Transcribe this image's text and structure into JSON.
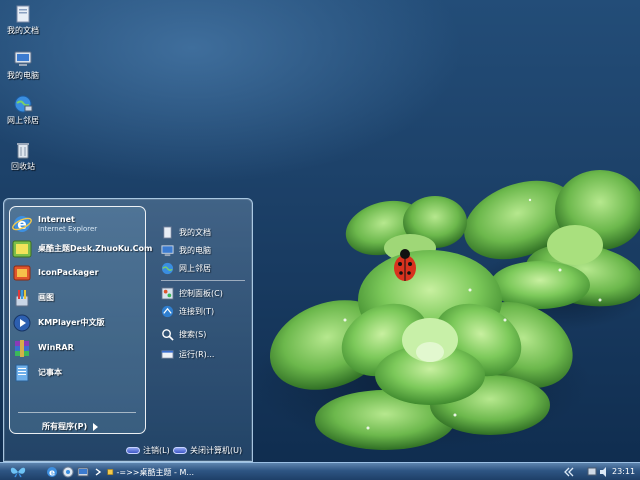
{
  "desktop": {
    "icons": [
      {
        "name": "my-documents",
        "label": "我的文档",
        "icon": "folder-icon"
      },
      {
        "name": "my-computer",
        "label": "我的电脑",
        "icon": "computer-icon"
      },
      {
        "name": "network-places",
        "label": "网上邻居",
        "icon": "network-globe-icon"
      },
      {
        "name": "recycle-bin",
        "label": "回收站",
        "icon": "recycle-bin-icon"
      }
    ]
  },
  "start_menu": {
    "pinned": [
      {
        "title": "Internet",
        "subtitle": "Internet Explorer",
        "icon": "ie-icon"
      },
      {
        "title": "桌酷主题Desk.ZhuoKu.Com",
        "icon": "theme-icon"
      },
      {
        "title": "IconPackager",
        "icon": "iconpackager-icon"
      },
      {
        "title": "画图",
        "icon": "paint-icon"
      },
      {
        "title": "KMPlayer中文版",
        "icon": "kmplayer-icon"
      },
      {
        "title": "WinRAR",
        "icon": "winrar-icon"
      },
      {
        "title": "记事本",
        "icon": "notepad-icon"
      }
    ],
    "all_programs": "所有程序(P)",
    "right": [
      {
        "label": "我的文档",
        "icon": "documents-icon"
      },
      {
        "label": "我的电脑",
        "icon": "computer-icon"
      },
      {
        "label": "网上邻居",
        "icon": "network-icon"
      },
      {
        "label": "控制面板(C)",
        "icon": "control-panel-icon"
      },
      {
        "label": "连接到(T)",
        "icon": "connect-icon"
      },
      {
        "label": "搜索(S)",
        "icon": "search-icon"
      },
      {
        "label": "运行(R)...",
        "icon": "run-icon"
      }
    ],
    "logoff": "注销(L)",
    "shutdown": "关闭计算机(U)"
  },
  "taskbar": {
    "task_label": "-=>>桌酷主题 - M...",
    "clock": "23:11"
  },
  "colors": {
    "accent": "#2e5583",
    "leaf_green": "#7cc95a",
    "ladybug_red": "#d8321e"
  }
}
